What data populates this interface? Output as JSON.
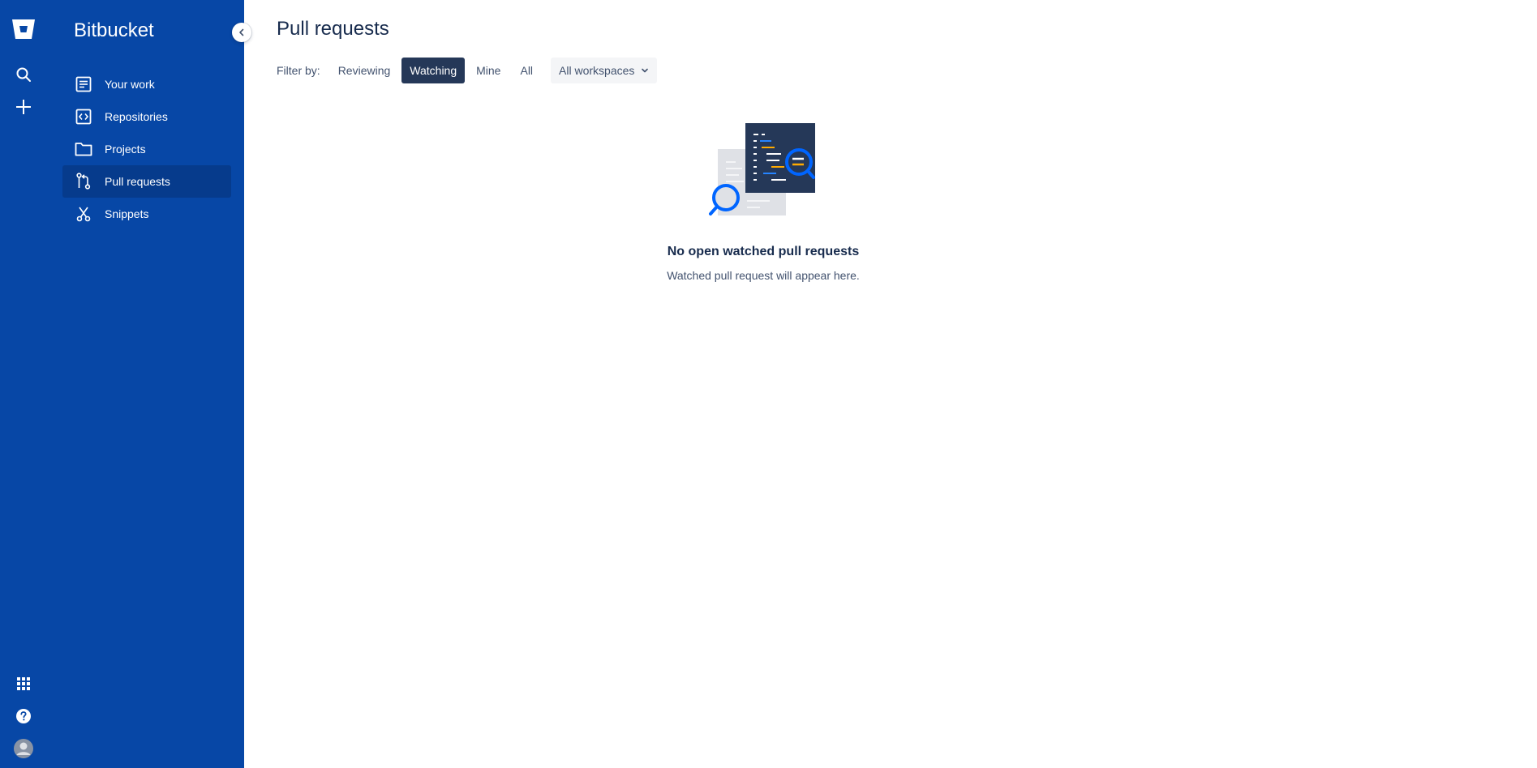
{
  "app": {
    "product_name": "Bitbucket"
  },
  "rail": {
    "icons": [
      "bitbucket-logo",
      "search-icon",
      "create-icon",
      "app-switcher-icon",
      "help-icon",
      "avatar"
    ]
  },
  "sidebar": {
    "items": [
      {
        "label": "Your work",
        "icon": "your-work-icon",
        "active": false
      },
      {
        "label": "Repositories",
        "icon": "repositories-icon",
        "active": false
      },
      {
        "label": "Projects",
        "icon": "projects-icon",
        "active": false
      },
      {
        "label": "Pull requests",
        "icon": "pull-requests-icon",
        "active": true
      },
      {
        "label": "Snippets",
        "icon": "snippets-icon",
        "active": false
      }
    ]
  },
  "main": {
    "title": "Pull requests",
    "filter": {
      "label": "Filter by:",
      "options": [
        "Reviewing",
        "Watching",
        "Mine",
        "All"
      ],
      "selected": "Watching",
      "workspace": "All workspaces"
    },
    "empty_state": {
      "title": "No open watched pull requests",
      "subtitle": "Watched pull request will appear here."
    }
  },
  "colors": {
    "sidebar_bg": "#0747a6",
    "sidebar_active": "#063b8c",
    "selected_filter_bg": "#253858",
    "text_primary": "#172b4d",
    "text_secondary": "#42526e"
  }
}
